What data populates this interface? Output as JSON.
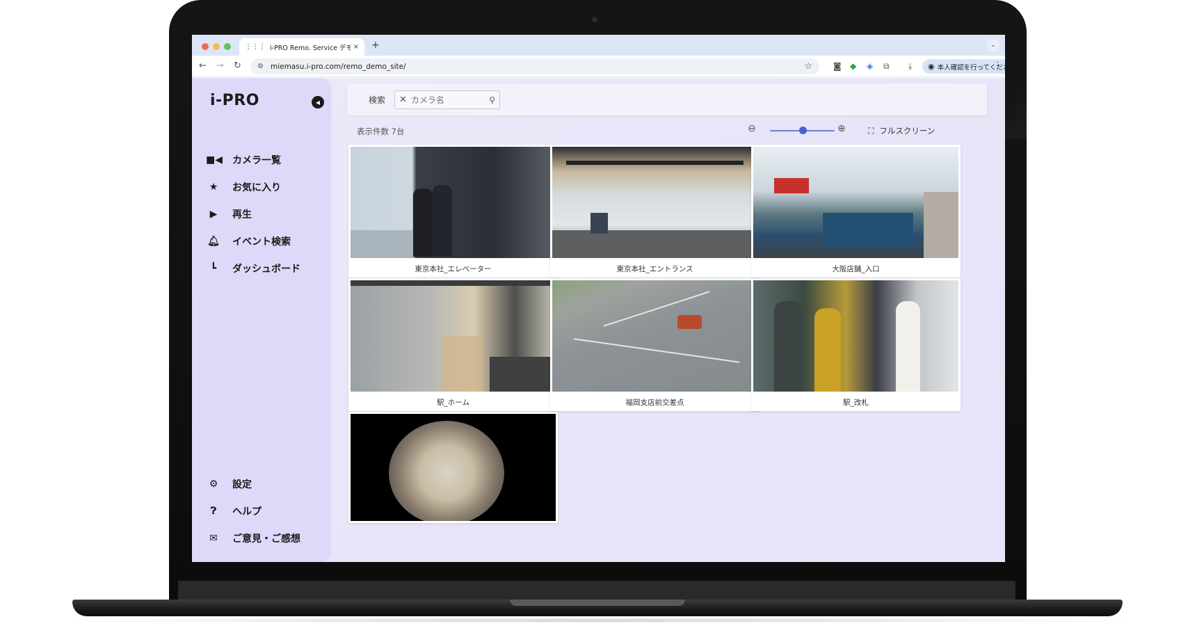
{
  "browser": {
    "tab_title": "i-PRO Remo. Service デモサイ",
    "tab_close": "×",
    "new_tab": "+",
    "url": "miemasu.i-pro.com/remo_demo_site/",
    "profile_button": "本人確認を行ってください"
  },
  "app": {
    "logo": "i-PRO",
    "search": {
      "label": "検索",
      "placeholder": "カメラ名"
    },
    "result_count": "表示件数 7台",
    "fullscreen_label": "フルスクリーン",
    "zoom_level": 0.5,
    "nav": [
      {
        "label": "カメラ一覧",
        "icon": "video-camera-icon"
      },
      {
        "label": "お気に入り",
        "icon": "star-icon"
      },
      {
        "label": "再生",
        "icon": "play-icon"
      },
      {
        "label": "イベント検索",
        "icon": "bell-icon"
      },
      {
        "label": "ダッシュボード",
        "icon": "chart-icon"
      }
    ],
    "nav_bottom": [
      {
        "label": "設定",
        "icon": "gear-icon"
      },
      {
        "label": "ヘルプ",
        "icon": "help-icon"
      },
      {
        "label": "ご意見・ご感想",
        "icon": "mail-icon"
      }
    ],
    "cameras": [
      {
        "name": "東京本社_エレベーター"
      },
      {
        "name": "東京本社_エントランス"
      },
      {
        "name": "大阪店舗_入口"
      },
      {
        "name": "駅_ホーム"
      },
      {
        "name": "福岡支店前交差点"
      },
      {
        "name": "駅_改札"
      },
      {
        "name": ""
      }
    ]
  }
}
